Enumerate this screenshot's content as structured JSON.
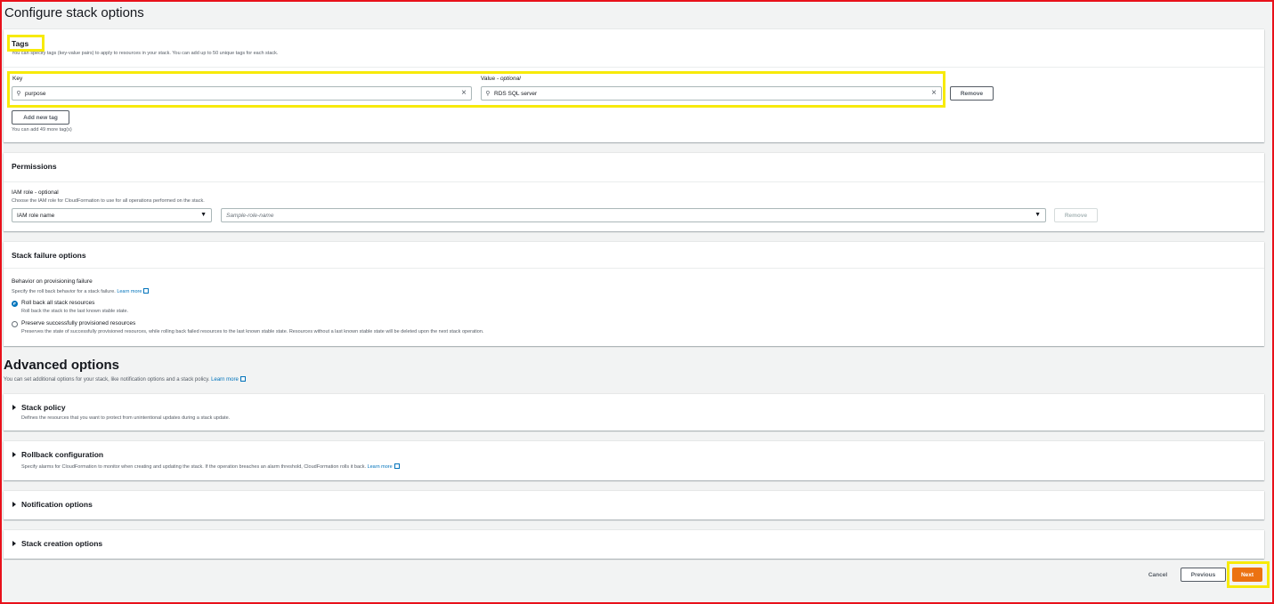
{
  "page": {
    "title": "Configure stack options"
  },
  "tags": {
    "title": "Tags",
    "description": "You can specify tags (key-value pairs) to apply to resources in your stack. You can add up to 50 unique tags for each stack.",
    "key_label": "Key",
    "value_label": "Value",
    "value_optional": "- optional",
    "rows": [
      {
        "key": "purpose",
        "value": "RDS SQL server",
        "remove_label": "Remove"
      }
    ],
    "add_label": "Add new tag",
    "remaining": "You can add 49 more tag(s)"
  },
  "permissions": {
    "title": "Permissions",
    "iam_label": "IAM role",
    "iam_optional": "- optional",
    "iam_desc": "Choose the IAM role for CloudFormation to use for all operations performed on the stack.",
    "role_type": "IAM role name",
    "role_placeholder": "Sample-role-name",
    "remove_label": "Remove"
  },
  "failure": {
    "title": "Stack failure options",
    "behavior_label": "Behavior on provisioning failure",
    "behavior_desc": "Specify the roll back behavior for a stack failure.",
    "learn_more": "Learn more",
    "options": [
      {
        "label": "Roll back all stack resources",
        "desc": "Roll back the stack to the last known stable state.",
        "checked": true
      },
      {
        "label": "Preserve successfully provisioned resources",
        "desc": "Preserves the state of successfully provisioned resources, while rolling back failed resources to the last known stable state. Resources without a last known stable state will be deleted upon the next stack operation.",
        "checked": false
      }
    ]
  },
  "advanced": {
    "title": "Advanced options",
    "desc": "You can set additional options for your stack, like notification options and a stack policy.",
    "learn_more": "Learn more",
    "sections": [
      {
        "title": "Stack policy",
        "desc": "Defines the resources that you want to protect from unintentional updates during a stack update."
      },
      {
        "title": "Rollback configuration",
        "desc": "Specify alarms for CloudFormation to monitor when creating and updating the stack. If the operation breaches an alarm threshold, CloudFormation rolls it back.",
        "learn_more": "Learn more"
      },
      {
        "title": "Notification options",
        "desc": ""
      },
      {
        "title": "Stack creation options",
        "desc": ""
      }
    ]
  },
  "footer": {
    "cancel": "Cancel",
    "previous": "Previous",
    "next": "Next"
  },
  "colors": {
    "primary": "#ec7211",
    "link": "#0073bb",
    "highlight": "#f7ea0a",
    "frame": "#e8111a"
  },
  "icons": {
    "search": "search-icon",
    "clear": "close-icon",
    "caret": "caret-down-icon",
    "expand": "caret-right-icon",
    "external": "external-link-icon"
  }
}
